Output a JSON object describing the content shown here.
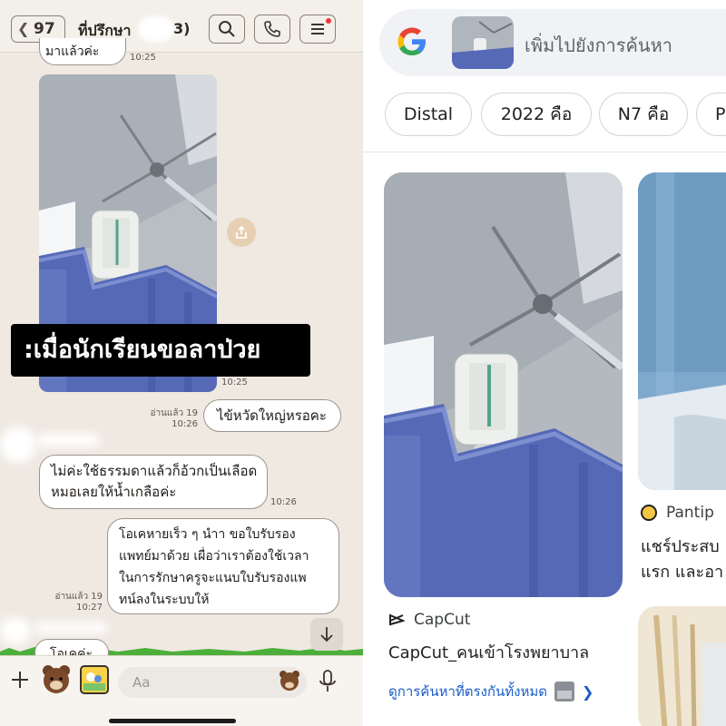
{
  "chat": {
    "back_count": "97",
    "title": "ที่ปรึกษา",
    "title_suffix": "3)",
    "first_msg_partial": "มาแล้วค่ะ",
    "first_msg_time": "10:25",
    "photo_time": "10:25",
    "overlay_caption": ":เมื่อนักเรียนขอลาป่วย",
    "read_label_1": "อ่านแล้ว 19",
    "read_time_1": "10:26",
    "msg_out_1": "ไข้หวัดใหญ่หรอคะ",
    "msg_in_2_line1": "ไม่ค่ะใช้ธรรมดาแล้วก็อ้วกเป็นเลือด",
    "msg_in_2_line2": "หมอเลยให้น้ำเกลือค่ะ",
    "msg_in_2_time": "10:26",
    "msg_out_2_lines": [
      "โอเคหายเร็ว ๆ นำา ขอใบรับรอง",
      "แพทย์มาด้วย เผื่อว่าเราต้องใช้เวลา",
      "ในการรักษาครูจะแนบใบรับรองแพ",
      "ทน์ลงในระบบให้"
    ],
    "read_label_2": "อ่านแล้ว 19",
    "read_time_2": "10:27",
    "msg_partial_last": "โอเคค่ะ",
    "input_placeholder": "Aa"
  },
  "lens": {
    "search_placeholder": "เพิ่มไปยังการค้นหา",
    "chips": [
      "Distal",
      "2022 คือ",
      "N7 คือ",
      "P"
    ],
    "result1": {
      "source": "CapCut",
      "title": "CapCut_คนเข้าโรงพยาบาล",
      "see_all": "ดูการค้นหาที่ตรงกันทั้งหมด"
    },
    "result2": {
      "source": "Pantip",
      "title_line1": "แชร์ประสบ",
      "title_line2": "แรก และอา"
    }
  },
  "colors": {
    "chat_bg": "#efe9e2",
    "link_blue": "#1a5cc8",
    "google_blue": "#4285F4",
    "google_red": "#EA4335",
    "google_yellow": "#FBBC05",
    "google_green": "#34A853"
  }
}
